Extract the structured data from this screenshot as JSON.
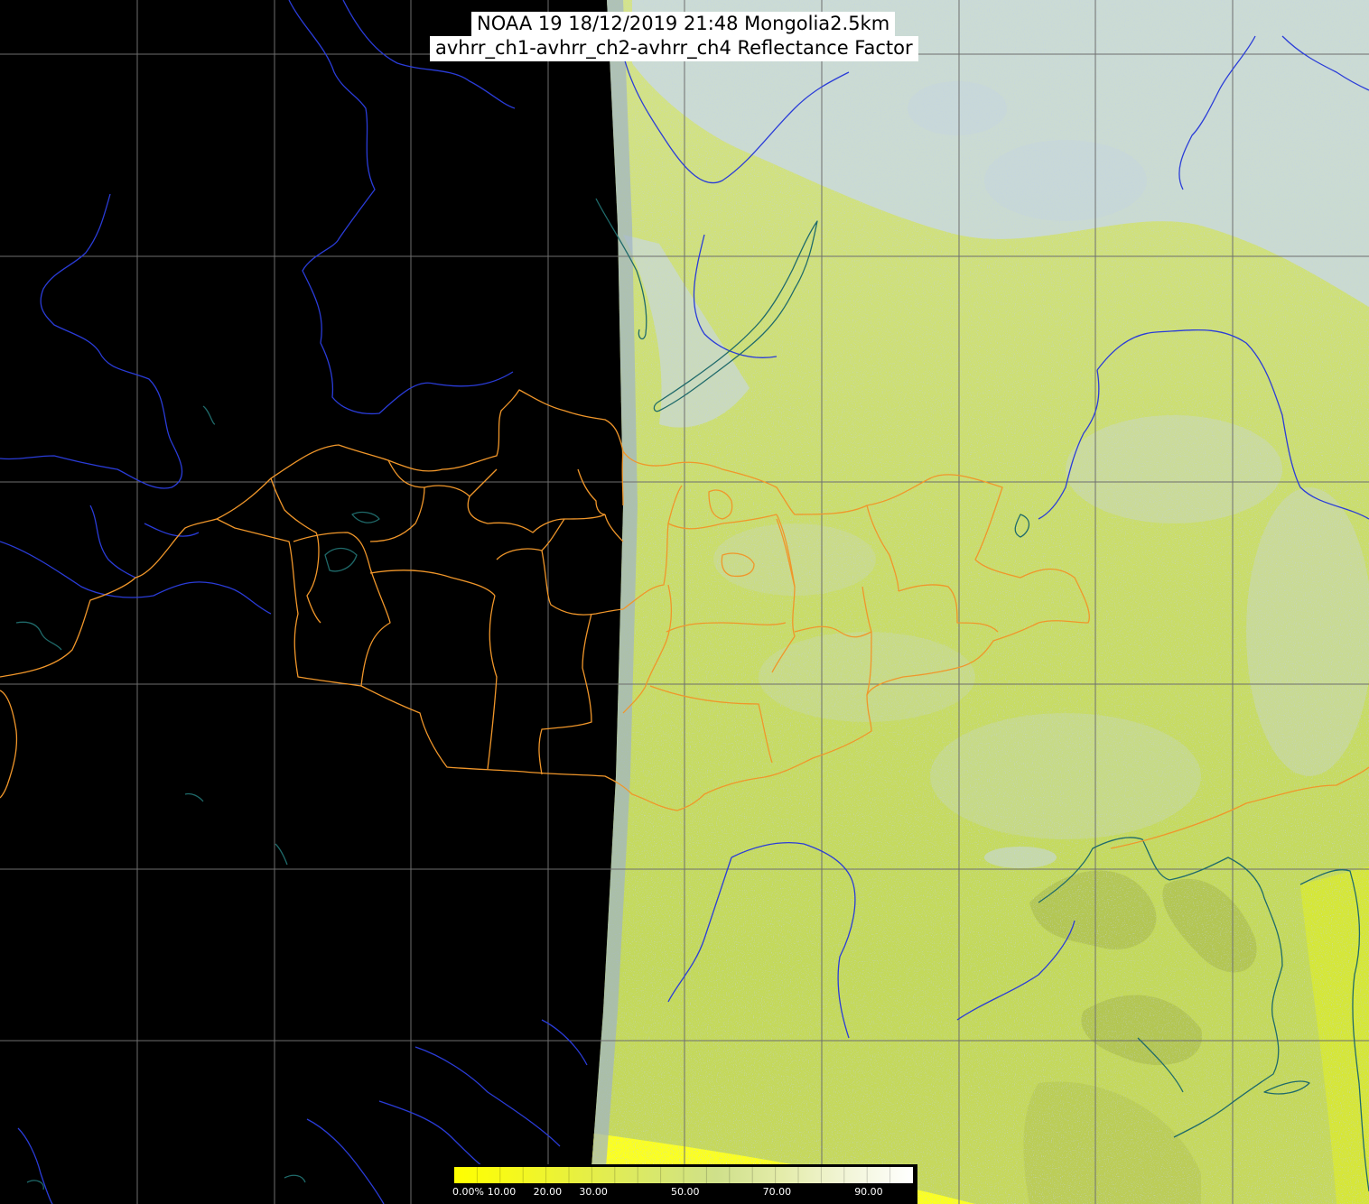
{
  "title": {
    "line1": "NOAA 19 18/12/2019 21:48 Mongolia2.5km",
    "line2": "avhrr_ch1-avhrr_ch2-avhrr_ch4 Reflectance Factor"
  },
  "colorbar": {
    "min": 0,
    "max": 100,
    "ticks": [
      {
        "value": 0,
        "label": "0.00%"
      },
      {
        "value": 10,
        "label": "10.00"
      },
      {
        "value": 20,
        "label": "20.00"
      },
      {
        "value": 30,
        "label": "30.00"
      },
      {
        "value": 50,
        "label": "50.00"
      },
      {
        "value": 70,
        "label": "70.00"
      },
      {
        "value": 90,
        "label": "90.00"
      }
    ],
    "colors": [
      "#ffff00",
      "#f4f820",
      "#e6ef45",
      "#d9e86a",
      "#cfe08a",
      "#e4ecaa",
      "#f2f5d8",
      "#ffffff"
    ]
  },
  "colors": {
    "background": "#000000",
    "land": "#c8dc66",
    "cloud": "#c9d8ee",
    "gridline": "#6e6e6e",
    "rivers": "#2a3cd8",
    "coast": "#1f6a6a",
    "admin_borders": "#f0962a"
  }
}
